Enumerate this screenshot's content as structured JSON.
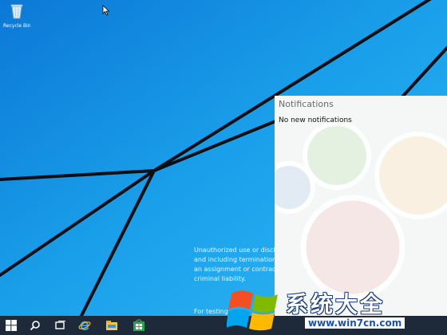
{
  "desktop": {
    "recycle_bin_label": "Recycle Bin",
    "watermark_lines": [
      "Unauthorized use or disclos",
      "and including termination o",
      "an assignment or contract (",
      "criminal liability."
    ],
    "build_note": "For testing"
  },
  "notifications": {
    "title": "Notifications",
    "empty_text": "No new notifications"
  },
  "taskbar": {
    "icons": [
      "windows-logo-icon",
      "search-icon",
      "task-view-icon",
      "internet-explorer-icon",
      "file-explorer-icon",
      "store-icon"
    ]
  },
  "brand": {
    "name": "系统大全",
    "url": "www.win7cn.com"
  },
  "colors": {
    "desktop_blue": "#1aa0ea",
    "taskbar": "#1e2a3a",
    "notification_bg": "#f4f7f6"
  }
}
